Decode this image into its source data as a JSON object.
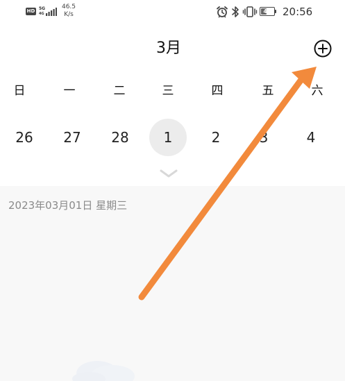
{
  "status_bar": {
    "hd_badge": "HD",
    "signal_5g": "5G",
    "signal_4g": "4G",
    "net_speed_value": "46.5",
    "net_speed_unit": "K/s",
    "battery_level": "44",
    "battery_fraction": 0.44,
    "time": "20:56",
    "icons": [
      "alarm-icon",
      "bluetooth-icon",
      "vibrate-icon",
      "battery-icon"
    ]
  },
  "header": {
    "month_title": "3月",
    "add_icon": "plus-circle-icon"
  },
  "calendar": {
    "weekdays": [
      "日",
      "一",
      "二",
      "三",
      "四",
      "五",
      "六"
    ],
    "dates": [
      "26",
      "27",
      "28",
      "1",
      "2",
      "3",
      "4"
    ],
    "selected_index": 3,
    "expand_icon": "chevron-down-icon"
  },
  "content": {
    "selected_date_text": "2023年03月01日  星期三",
    "illustration": "cloud-illustration"
  },
  "annotation": {
    "arrow_color": "#f28a3c"
  }
}
